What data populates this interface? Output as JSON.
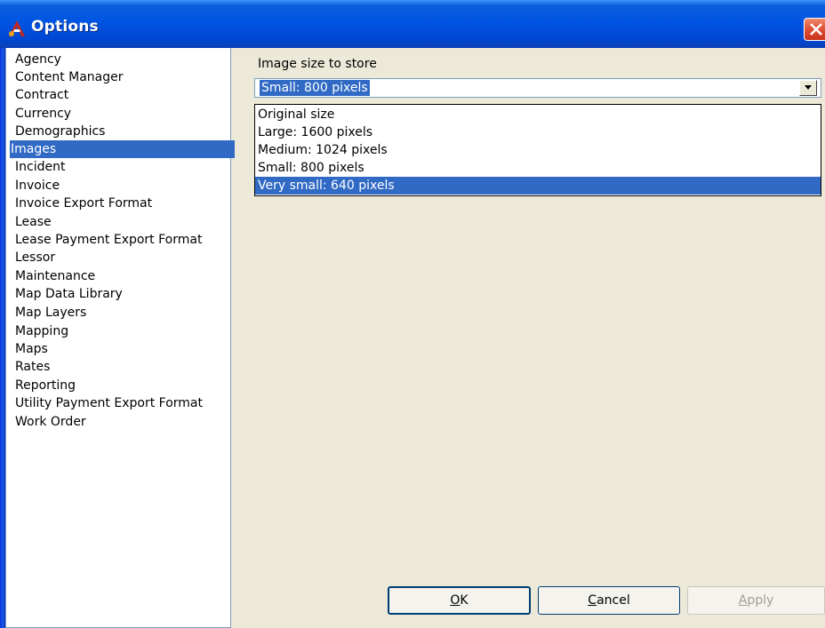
{
  "window": {
    "title": "Options",
    "app_icon": "app-logo-icon",
    "close_icon": "close-icon",
    "colors": {
      "titlebar": "#0054e3",
      "selection": "#316ac5",
      "close_button": "#e0543a",
      "background": "#ece9d8"
    }
  },
  "sidebar": {
    "items": [
      {
        "label": "Agency",
        "selected": false
      },
      {
        "label": "Content Manager",
        "selected": false
      },
      {
        "label": "Contract",
        "selected": false
      },
      {
        "label": "Currency",
        "selected": false
      },
      {
        "label": "Demographics",
        "selected": false
      },
      {
        "label": "Images",
        "selected": true
      },
      {
        "label": "Incident",
        "selected": false
      },
      {
        "label": "Invoice",
        "selected": false
      },
      {
        "label": "Invoice Export Format",
        "selected": false
      },
      {
        "label": "Lease",
        "selected": false
      },
      {
        "label": "Lease Payment Export Format",
        "selected": false
      },
      {
        "label": "Lessor",
        "selected": false
      },
      {
        "label": "Maintenance",
        "selected": false
      },
      {
        "label": "Map Data Library",
        "selected": false
      },
      {
        "label": "Map Layers",
        "selected": false
      },
      {
        "label": "Mapping",
        "selected": false
      },
      {
        "label": "Maps",
        "selected": false
      },
      {
        "label": "Rates",
        "selected": false
      },
      {
        "label": "Reporting",
        "selected": false
      },
      {
        "label": "Utility Payment Export Format",
        "selected": false
      },
      {
        "label": "Work Order",
        "selected": false
      }
    ]
  },
  "main": {
    "field_label": "Image size to store",
    "combo": {
      "value": "Small: 800 pixels",
      "arrow_icon": "chevron-down-icon"
    },
    "dropdown_options": [
      {
        "label": "Original size",
        "highlighted": false
      },
      {
        "label": "Large: 1600 pixels",
        "highlighted": false
      },
      {
        "label": "Medium: 1024 pixels",
        "highlighted": false
      },
      {
        "label": "Small: 800 pixels",
        "highlighted": false
      },
      {
        "label": "Very small: 640 pixels",
        "highlighted": true
      }
    ]
  },
  "buttons": {
    "ok": {
      "mnemonic": "O",
      "rest": "K"
    },
    "cancel": {
      "mnemonic": "C",
      "rest": "ancel"
    },
    "apply": {
      "mnemonic": "A",
      "rest": "pply",
      "disabled": true
    }
  }
}
